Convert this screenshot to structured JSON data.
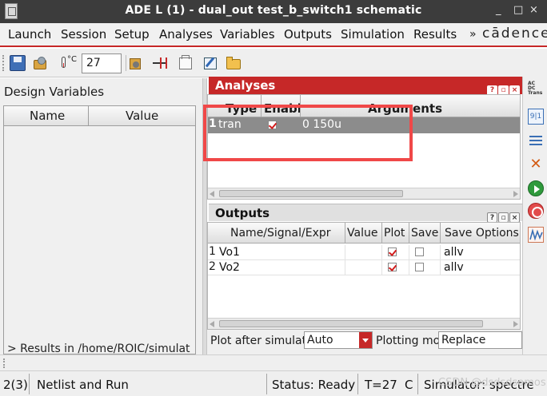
{
  "window": {
    "title": "ADE L (1) - dual_out test_b_switch1 schematic",
    "minimize": "_",
    "maximize": "□",
    "close": "×"
  },
  "menu": {
    "items": [
      {
        "label": "Launch"
      },
      {
        "label": "Session"
      },
      {
        "label": "Setup"
      },
      {
        "label": "Analyses"
      },
      {
        "label": "Variables"
      },
      {
        "label": "Outputs"
      },
      {
        "label": "Simulation"
      },
      {
        "label": "Results"
      }
    ],
    "more": "»",
    "brand": "cādence"
  },
  "toolbar": {
    "temperature_unit": "°C",
    "temperature_value": "27"
  },
  "design_variables": {
    "title": "Design Variables",
    "columns": [
      "Name",
      "Value"
    ],
    "results_path": "> Results in /home/ROIC/simulat"
  },
  "analyses": {
    "title": "Analyses",
    "columns": [
      "Type",
      "Enable",
      "Arguments"
    ],
    "rows": [
      {
        "index": "1",
        "type": "tran",
        "enabled": true,
        "arguments": "0 150u"
      }
    ]
  },
  "outputs": {
    "title": "Outputs",
    "columns": [
      "Name/Signal/Expr",
      "Value",
      "Plot",
      "Save",
      "Save Options"
    ],
    "rows": [
      {
        "index": "1",
        "name": "Vo1",
        "value": "",
        "plot": true,
        "save": false,
        "save_options": "allv"
      },
      {
        "index": "2",
        "name": "Vo2",
        "value": "",
        "plot": true,
        "save": false,
        "save_options": "allv"
      }
    ]
  },
  "plot_controls": {
    "plot_after_label": "Plot after simulation:",
    "plot_after_value": "Auto",
    "plotting_mode_label": "Plotting mode:",
    "plotting_mode_value": "Replace"
  },
  "side_toolbar": {
    "acdc_label": [
      "AC",
      "DC",
      "Trans"
    ],
    "variables_glyph": "9|1"
  },
  "status": {
    "count": "2(3)",
    "action": "Netlist and Run",
    "state": "Status: Ready",
    "temperature": "T=27",
    "unit": "C",
    "simulator": "Simulator: spectre"
  },
  "watermark": "CSDN @dsdsdsomos",
  "colors": {
    "accent": "#c62828",
    "titlebar": "#3c3c3c",
    "selected_row": "#8c8c8c",
    "highlight_box": "#f04848"
  }
}
